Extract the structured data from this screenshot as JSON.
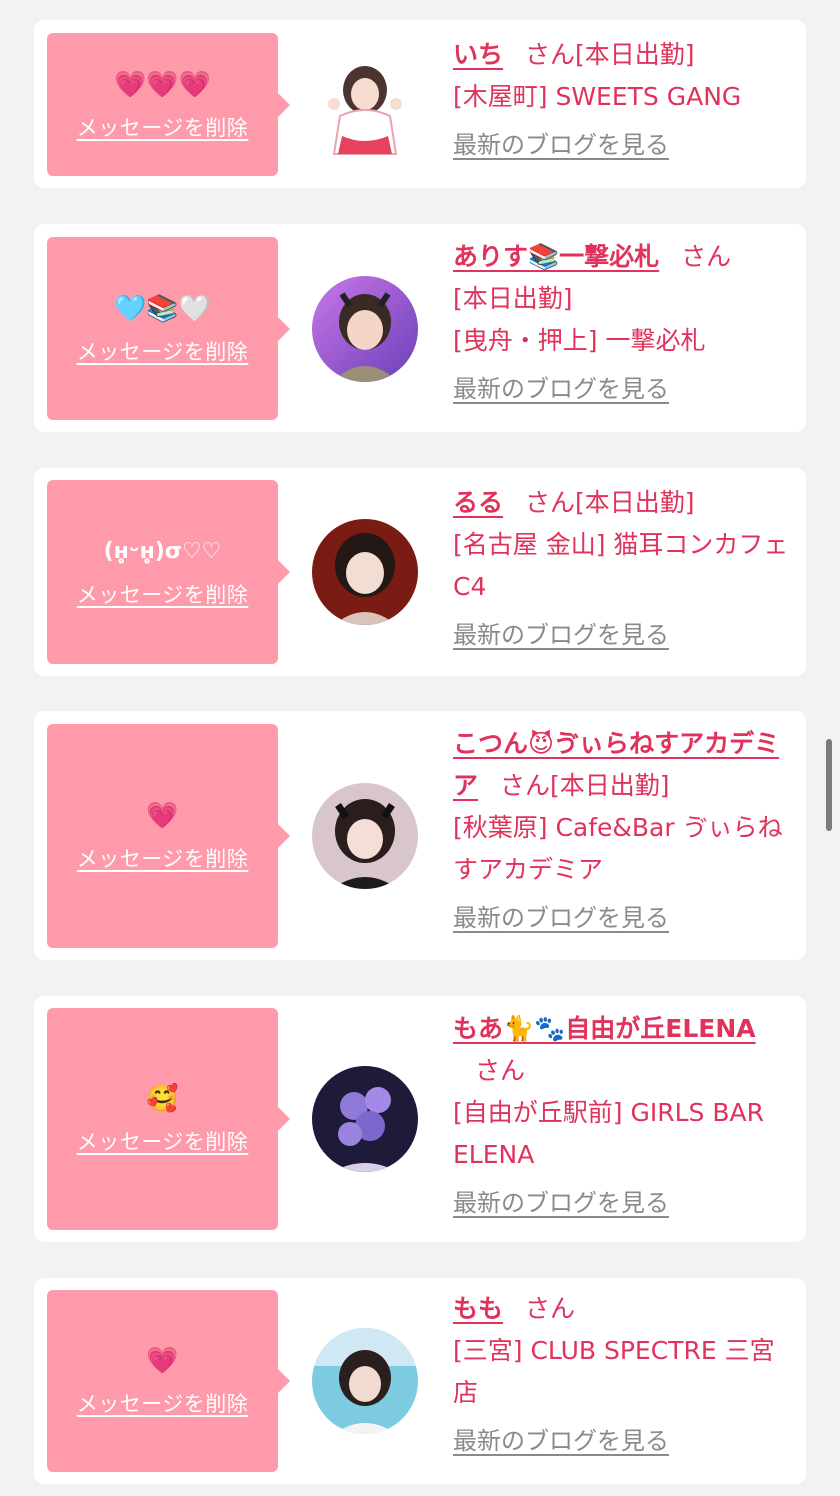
{
  "delete_label": "メッセージを削除",
  "blog_label": "最新のブログを見る",
  "san_label": "さん",
  "colors": {
    "bubble": "#fe9aaa",
    "accent": "#e0325a",
    "link_gray": "#8a8a8a",
    "background": "#f2f2f2"
  },
  "entries": [
    {
      "message": "💗💗💗",
      "name": "いち",
      "status": "[本日出勤]",
      "shop": "[木屋町] SWEETS GANG",
      "avatar_icon": "cast-photo-icon"
    },
    {
      "message": "🩵📚🤍",
      "name": "ありす📚一撃必札",
      "status": "[本日出勤]",
      "shop": "[曳舟・押上] 一撃必札",
      "avatar_icon": "cast-photo-icon"
    },
    {
      "message": "(ʜ̥̥̥̥̥̥̥ᵕʜ̥̥̥̥̥̥̥)σ♡♡",
      "name": "るる",
      "status": "[本日出勤]",
      "shop": "[名古屋 金山] 猫耳コンカフェ C4",
      "avatar_icon": "cast-photo-icon"
    },
    {
      "message": "💗",
      "name": "こつん😈ゔぃらねすアカデミア",
      "status": "[本日出勤]",
      "shop": "[秋葉原] Cafe&Bar ゔぃらねすアカデミア",
      "avatar_icon": "cast-photo-icon"
    },
    {
      "message": "🥰",
      "name": "もあ🐈🐾自由が丘ELENA",
      "status": "",
      "shop": "[自由が丘駅前] GIRLS BAR ELENA",
      "avatar_icon": "cast-photo-icon"
    },
    {
      "message": "💗",
      "name": "もも",
      "status": "",
      "shop": "[三宮] CLUB SPECTRE 三宮店",
      "avatar_icon": "cast-photo-icon"
    }
  ]
}
